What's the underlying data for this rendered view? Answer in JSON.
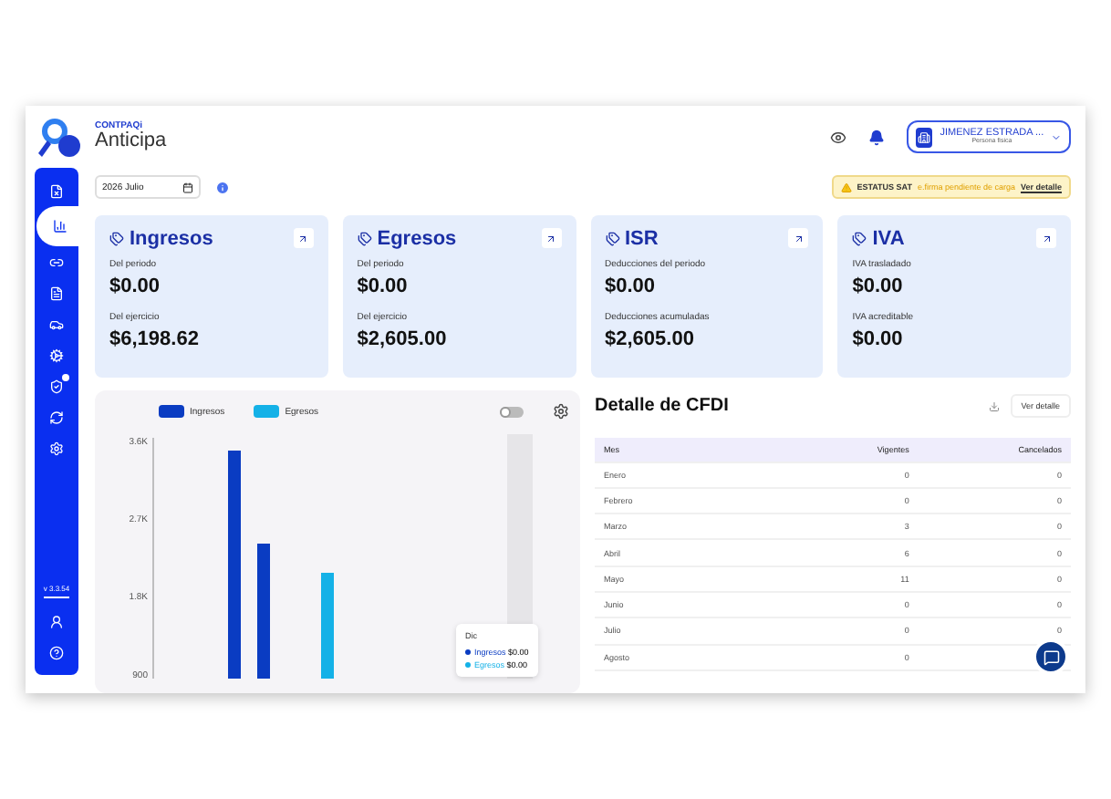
{
  "header": {
    "brand_small": "CONTPAQi",
    "brand": "Anticipa",
    "user": {
      "name": "JIMENEZ ESTRADA ...",
      "role": "Persona fisica"
    }
  },
  "sidebar": {
    "items": [
      {
        "selected": false
      },
      {
        "selected": true
      },
      {
        "selected": false
      },
      {
        "selected": false
      },
      {
        "selected": false
      },
      {
        "selected": false
      },
      {
        "selected": false,
        "badge": true
      },
      {
        "selected": false
      },
      {
        "selected": false
      }
    ],
    "version": "v 3.3.54"
  },
  "period": {
    "value": "2026 Julio"
  },
  "status_banner": {
    "label": "ESTATUS SAT",
    "message": "e.firma pendiente de carga",
    "link": "Ver detalle"
  },
  "cards": [
    {
      "title": "Ingresos",
      "label_1": "Del periodo",
      "value_1": "$0.00",
      "label_2": "Del ejercicio",
      "value_2": "$6,198.62"
    },
    {
      "title": "Egresos",
      "label_1": "Del periodo",
      "value_1": "$0.00",
      "label_2": "Del ejercicio",
      "value_2": "$2,605.00"
    },
    {
      "title": "ISR",
      "label_1": "Deducciones del periodo",
      "value_1": "$0.00",
      "label_2": "Deducciones acumuladas",
      "value_2": "$2,605.00"
    },
    {
      "title": "IVA",
      "label_1": "IVA trasladado",
      "value_1": "$0.00",
      "label_2": "IVA acreditable",
      "value_2": "$0.00"
    }
  ],
  "chart_panel": {
    "toggle_on": false,
    "legend": [
      {
        "name": "Ingresos",
        "color": "#0a3cc2"
      },
      {
        "name": "Egresos",
        "color": "#14b1e7"
      }
    ],
    "y_ticks": [
      "3.6K",
      "2.7K",
      "1.8K",
      "900"
    ],
    "tooltip": {
      "title": "Dic",
      "rows": [
        {
          "name": "Ingresos",
          "value": "$0.00",
          "color": "#0a3cc2"
        },
        {
          "name": "Egresos",
          "value": "$0.00",
          "color": "#14b1e7"
        }
      ]
    }
  },
  "cfdi": {
    "title": "Detalle de CFDI",
    "button": "Ver detalle",
    "columns": [
      "Mes",
      "Vigentes",
      "Cancelados"
    ],
    "rows": [
      {
        "mes": "Enero",
        "vigentes": "0",
        "cancelados": "0"
      },
      {
        "mes": "Febrero",
        "vigentes": "0",
        "cancelados": "0"
      },
      {
        "mes": "Marzo",
        "vigentes": "3",
        "cancelados": "0"
      },
      {
        "mes": "Abril",
        "vigentes": "6",
        "cancelados": "0"
      },
      {
        "mes": "Mayo",
        "vigentes": "11",
        "cancelados": "0"
      },
      {
        "mes": "Junio",
        "vigentes": "0",
        "cancelados": "0"
      },
      {
        "mes": "Julio",
        "vigentes": "0",
        "cancelados": "0"
      },
      {
        "mes": "Agosto",
        "vigentes": "0"
      }
    ]
  }
}
